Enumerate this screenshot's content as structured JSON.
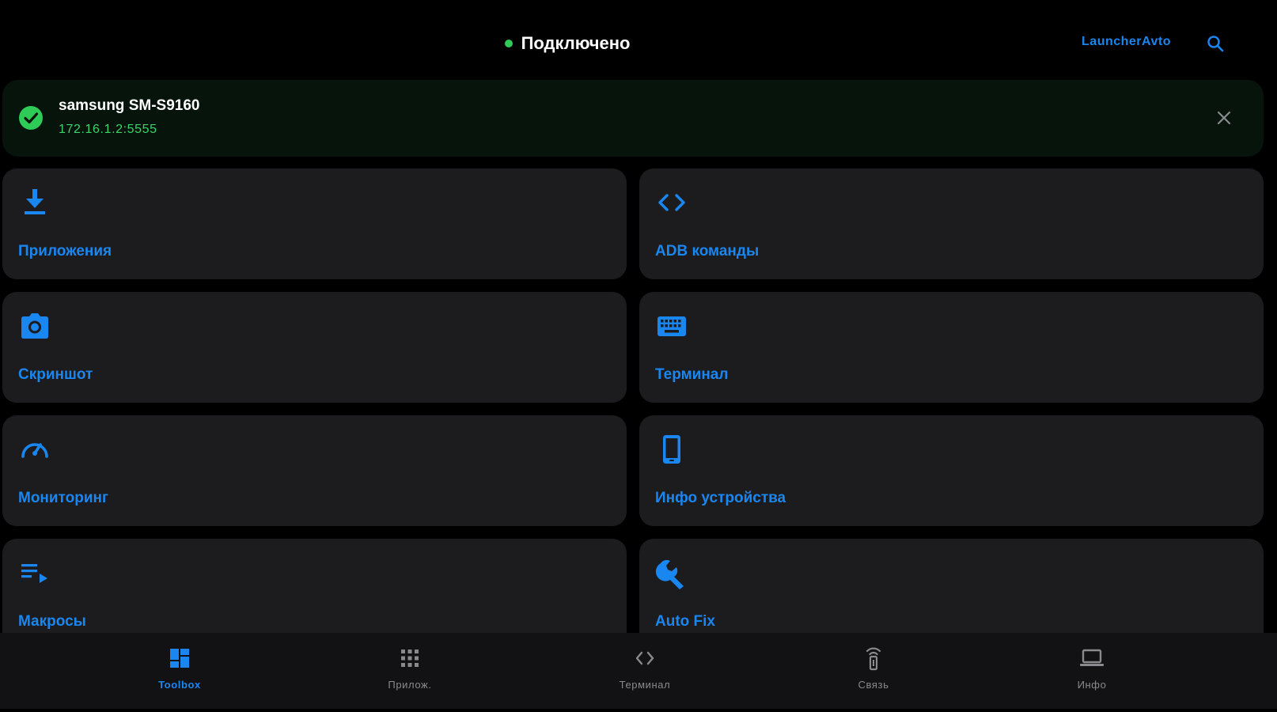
{
  "colors": {
    "accent": "#1a86f0",
    "success": "#2ecc57",
    "success_text": "#3ad468",
    "inactive": "#8a8a8e",
    "tile_bg": "#1c1c1e"
  },
  "header": {
    "status": "Подключено",
    "app_link": "LauncherAvto",
    "search_icon": "search-icon"
  },
  "device": {
    "name": "samsung SM-S9160",
    "address": "172.16.1.2:5555",
    "status_icon": "check-circle-icon",
    "close_icon": "close-icon"
  },
  "tiles": [
    {
      "label": "Приложения",
      "icon": "download-icon"
    },
    {
      "label": "ADB команды",
      "icon": "code-icon"
    },
    {
      "label": "Скриншот",
      "icon": "camera-icon"
    },
    {
      "label": "Терминал",
      "icon": "keyboard-icon"
    },
    {
      "label": "Мониторинг",
      "icon": "speedometer-icon"
    },
    {
      "label": "Инфо устройства",
      "icon": "phone-icon"
    },
    {
      "label": "Макросы",
      "icon": "playlist-play-icon"
    },
    {
      "label": "Auto Fix",
      "icon": "wrench-icon"
    }
  ],
  "nav": {
    "active_index": 0,
    "items": [
      {
        "label": "Toolbox",
        "icon": "dashboard-icon"
      },
      {
        "label": "Прилож.",
        "icon": "apps-grid-icon"
      },
      {
        "label": "Терминал",
        "icon": "code-icon"
      },
      {
        "label": "Связь",
        "icon": "antenna-icon"
      },
      {
        "label": "Инфо",
        "icon": "laptop-icon"
      }
    ]
  }
}
